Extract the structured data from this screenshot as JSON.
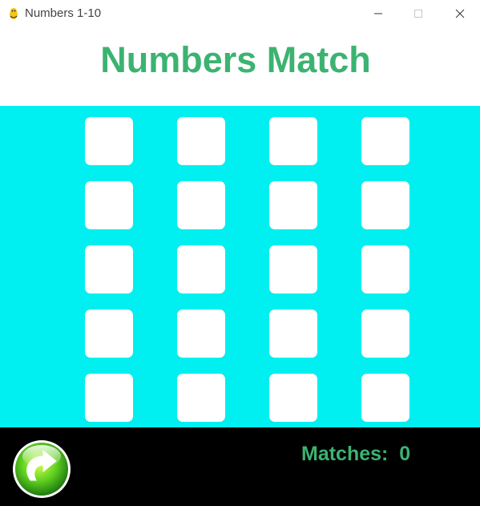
{
  "window": {
    "title": "Numbers 1-10",
    "icon": "pygame-snake-icon",
    "controls": [
      "minimize-icon",
      "maximize-icon",
      "close-icon"
    ]
  },
  "game": {
    "title": "Numbers Match",
    "title_color": "#3cb371",
    "board_color": "#00eff0",
    "card_color": "#ffffff",
    "footer_color": "#000000",
    "grid": {
      "rows": 5,
      "columns": 4,
      "cards_face_down": 20
    },
    "restart_icon": "restart-arrow-icon",
    "matches_label": "Matches:",
    "matches_value": "0"
  }
}
